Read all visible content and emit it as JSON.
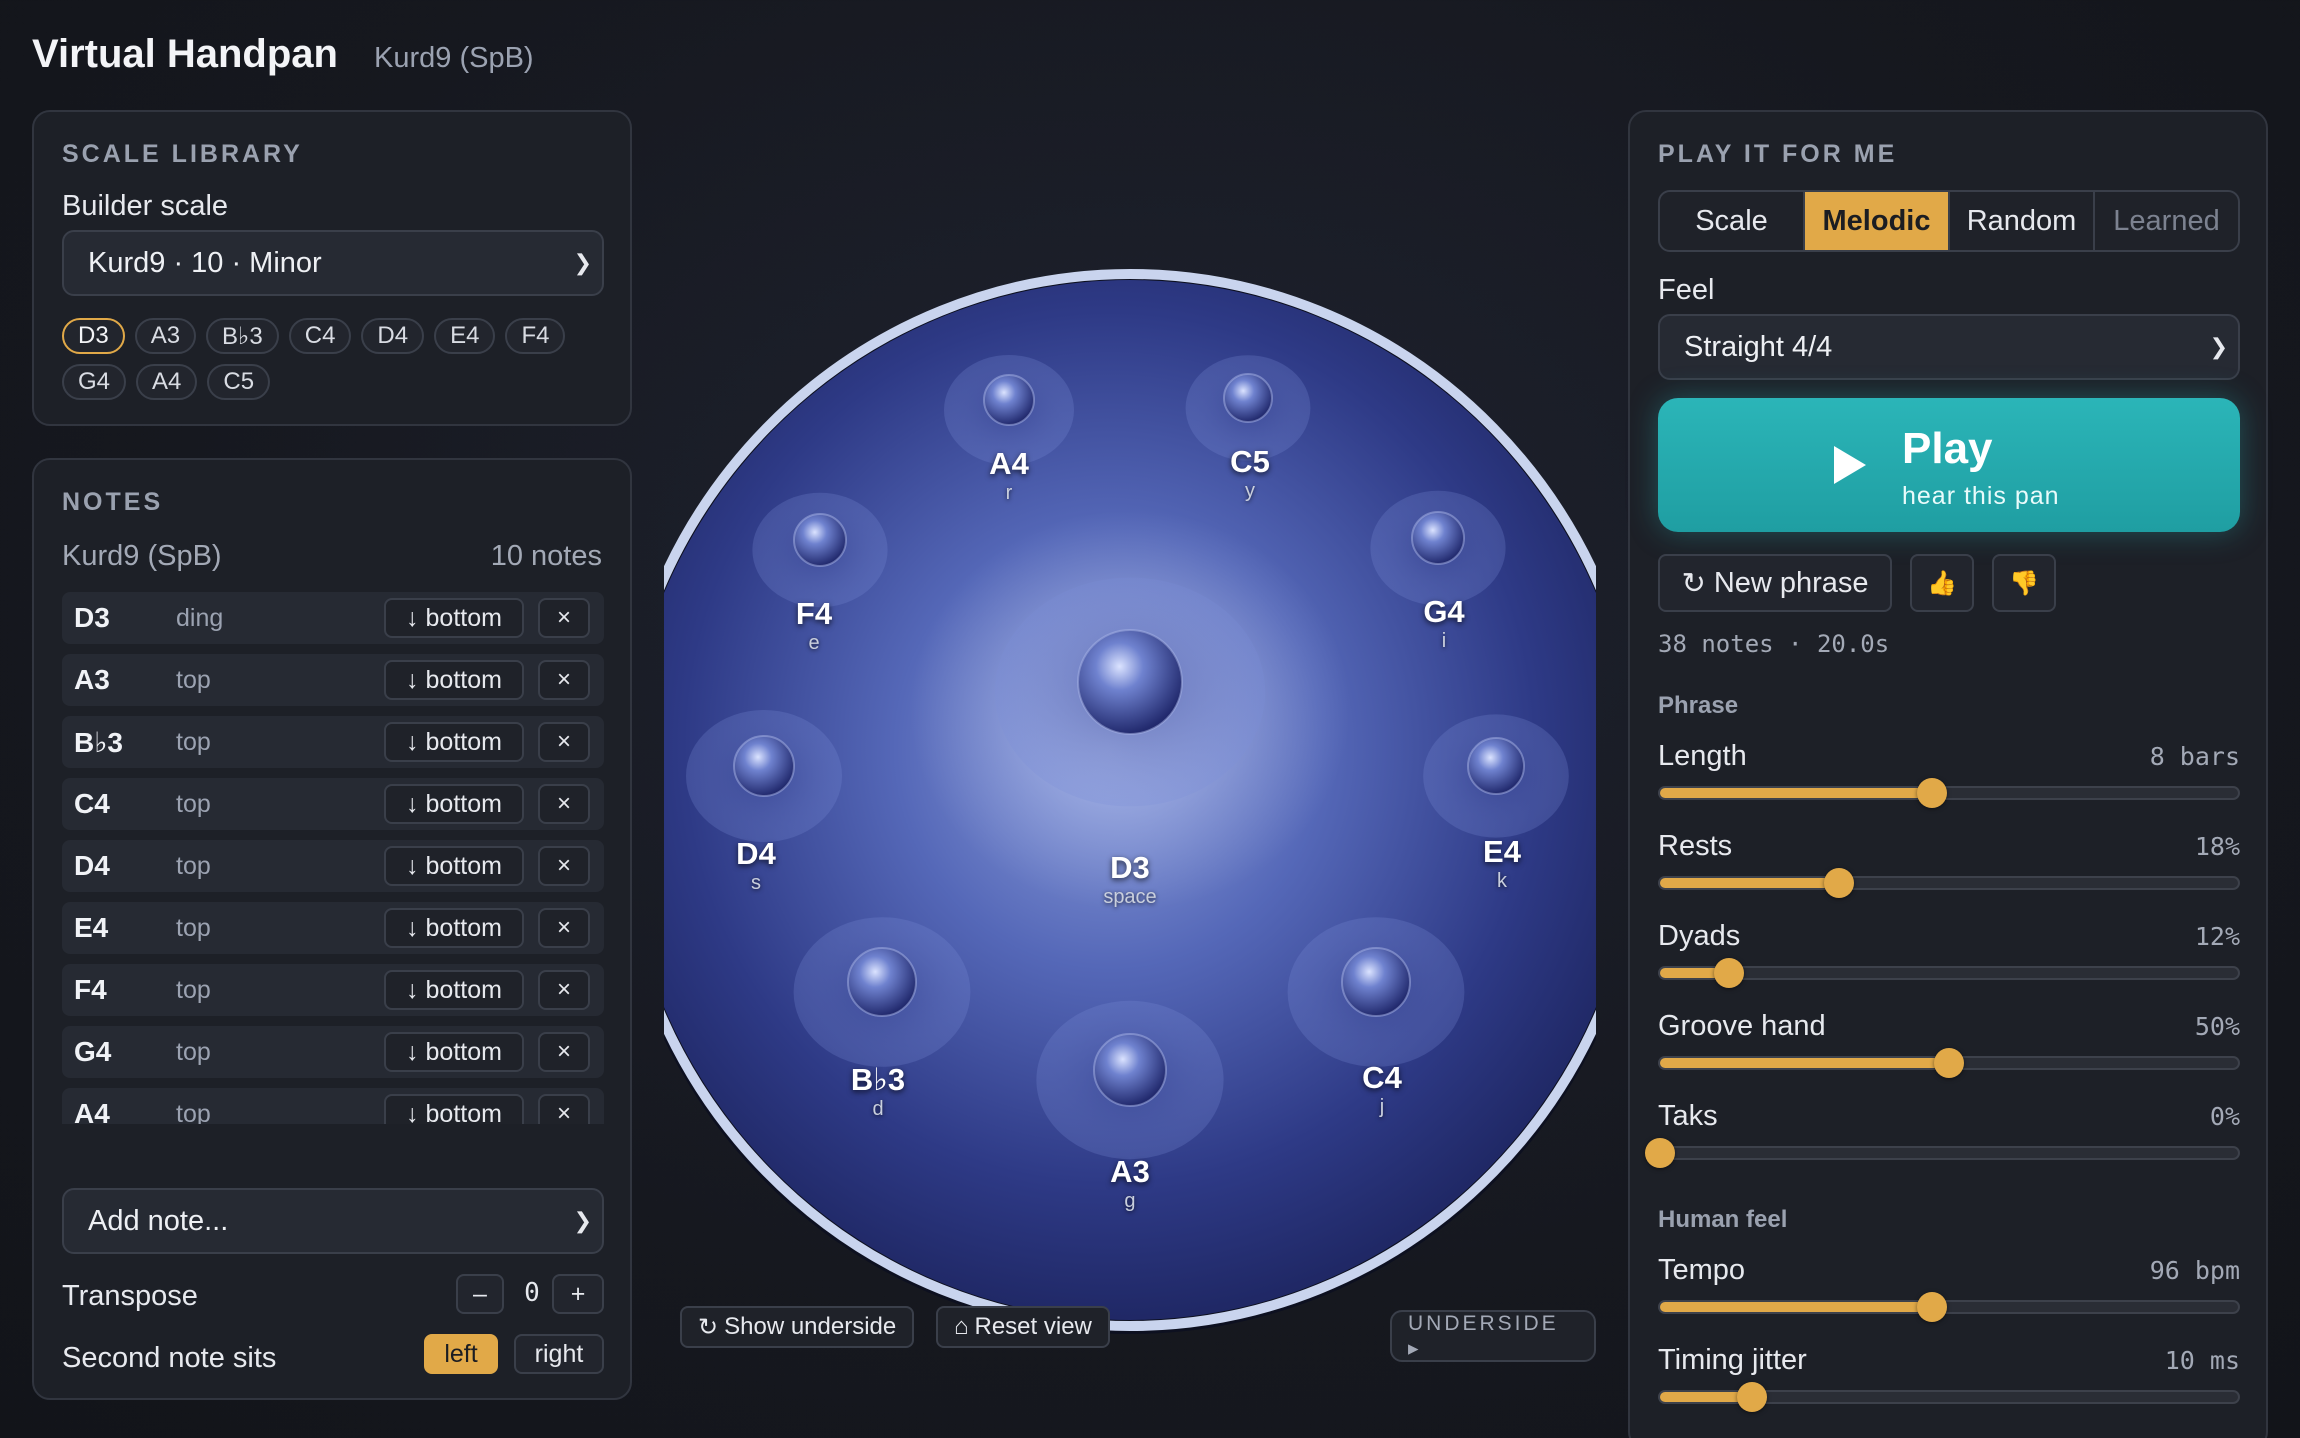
{
  "app": {
    "title": "Virtual Handpan",
    "subtitle": "Kurd9 (SpB)"
  },
  "colors": {
    "accent": "#e1a948",
    "play": "#2bb5b8",
    "panel": "#1d2027"
  },
  "scale_library": {
    "title": "SCALE LIBRARY",
    "builder_label": "Builder scale",
    "builder_value": "Kurd9 · 10 · Minor",
    "chips": [
      "D3",
      "A3",
      "B♭3",
      "C4",
      "D4",
      "E4",
      "F4",
      "G4",
      "A4",
      "C5"
    ],
    "active_chip": 0
  },
  "notes": {
    "title": "NOTES",
    "scale_name": "Kurd9 (SpB)",
    "count": "10 notes",
    "rows": [
      {
        "name": "D3",
        "pos": "ding",
        "action": "↓ bottom",
        "remove": "×"
      },
      {
        "name": "A3",
        "pos": "top",
        "action": "↓ bottom",
        "remove": "×"
      },
      {
        "name": "B♭3",
        "pos": "top",
        "action": "↓ bottom",
        "remove": "×"
      },
      {
        "name": "C4",
        "pos": "top",
        "action": "↓ bottom",
        "remove": "×"
      },
      {
        "name": "D4",
        "pos": "top",
        "action": "↓ bottom",
        "remove": "×"
      },
      {
        "name": "E4",
        "pos": "top",
        "action": "↓ bottom",
        "remove": "×"
      },
      {
        "name": "F4",
        "pos": "top",
        "action": "↓ bottom",
        "remove": "×"
      },
      {
        "name": "G4",
        "pos": "top",
        "action": "↓ bottom",
        "remove": "×"
      },
      {
        "name": "A4",
        "pos": "top",
        "action": "↓ bottom",
        "remove": "×"
      }
    ],
    "add_note_placeholder": "Add note...",
    "transpose_label": "Transpose",
    "transpose_minus": "–",
    "transpose_value": "0",
    "transpose_plus": "+",
    "second_note_label": "Second note sits",
    "second_note_left": "left",
    "second_note_right": "right"
  },
  "handpan": {
    "tones": [
      {
        "name": "A4",
        "key": "r"
      },
      {
        "name": "C5",
        "key": "y"
      },
      {
        "name": "F4",
        "key": "e"
      },
      {
        "name": "G4",
        "key": "i"
      },
      {
        "name": "D4",
        "key": "s"
      },
      {
        "name": "E4",
        "key": "k"
      },
      {
        "name": "D3",
        "key": "space"
      },
      {
        "name": "B♭3",
        "key": "d"
      },
      {
        "name": "C4",
        "key": "j"
      },
      {
        "name": "A3",
        "key": "g"
      }
    ],
    "show_underside": "Show underside",
    "reset_view": "Reset view",
    "underside_tag": "UNDERSIDE ▸",
    "refresh_icon": "↻",
    "home_icon": "⌂"
  },
  "play": {
    "title": "PLAY IT FOR ME",
    "modes": [
      "Scale",
      "Melodic",
      "Random",
      "Learned"
    ],
    "active_mode": 1,
    "feel_label": "Feel",
    "feel_value": "Straight 4/4",
    "play_label": "Play",
    "play_sub": "hear this pan",
    "new_phrase": "New phrase",
    "thumb_up": "👍",
    "thumb_down": "👎",
    "stats": "38 notes · 20.0s",
    "phrase_section": "Phrase",
    "human_section": "Human feel",
    "sliders": [
      {
        "name": "Length",
        "value": "8 bars",
        "fraction": 0.47
      },
      {
        "name": "Rests",
        "value": "18%",
        "fraction": 0.31
      },
      {
        "name": "Dyads",
        "value": "12%",
        "fraction": 0.12
      },
      {
        "name": "Groove hand",
        "value": "50%",
        "fraction": 0.5
      },
      {
        "name": "Taks",
        "value": "0%",
        "fraction": 0.0
      }
    ],
    "human_sliders": [
      {
        "name": "Tempo",
        "value": "96 bpm",
        "fraction": 0.47
      },
      {
        "name": "Timing jitter",
        "value": "10 ms",
        "fraction": 0.16
      }
    ]
  }
}
